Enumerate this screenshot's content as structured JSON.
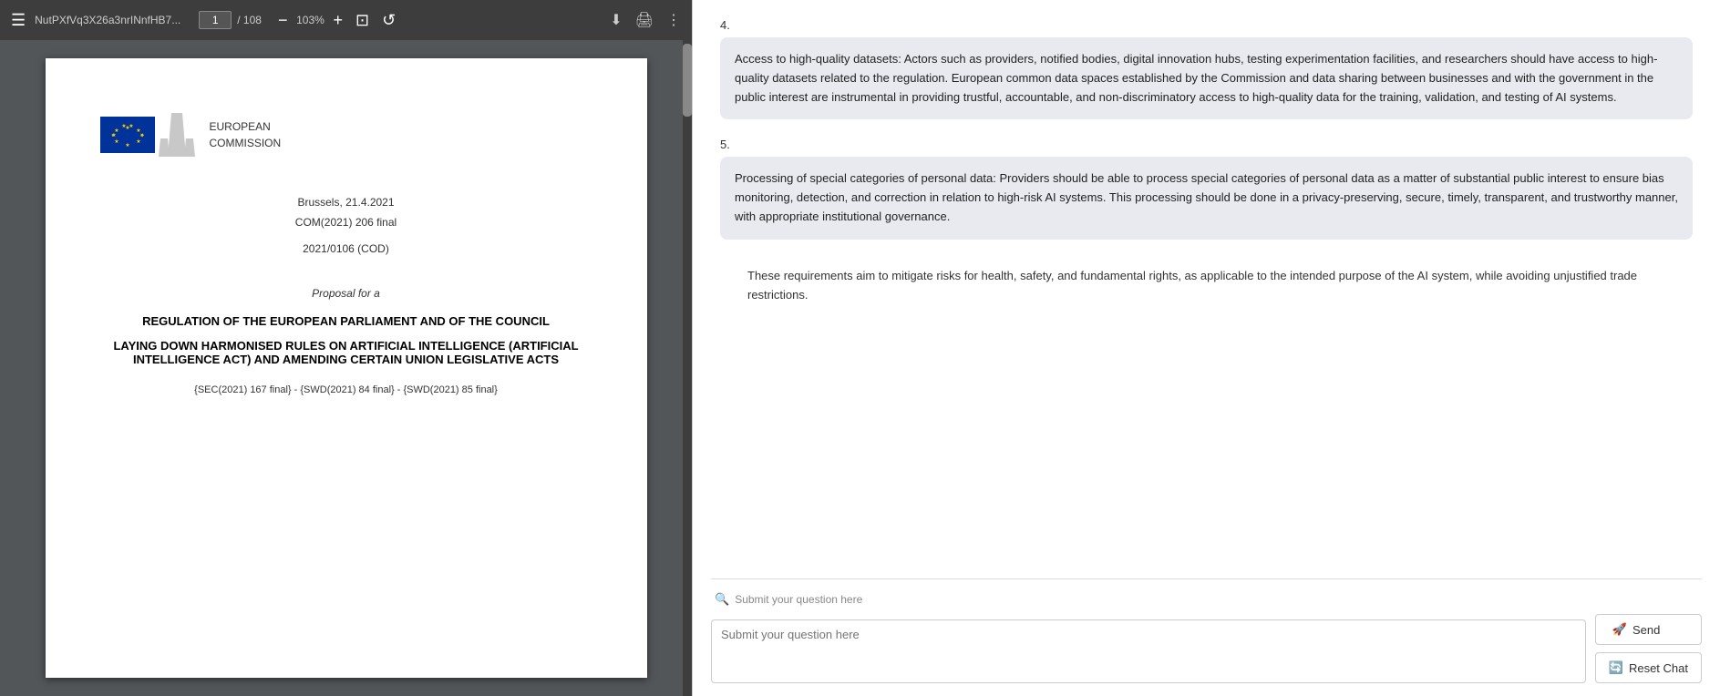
{
  "pdf": {
    "toolbar": {
      "hamburger_label": "☰",
      "filename": "NutPXfVq3X26a3nrINnfHB7...",
      "page_current": "1",
      "page_separator": "/ 108",
      "zoom_minus": "−",
      "zoom_value": "103%",
      "zoom_plus": "+",
      "icon_fit": "⊡",
      "icon_rotate": "↺",
      "icon_download": "⬇",
      "icon_print": "🖨",
      "icon_more": "⋮"
    },
    "document": {
      "eu_text_line1": "EUROPEAN",
      "eu_text_line2": "COMMISSION",
      "meta_line1": "Brussels, 21.4.2021",
      "meta_line2": "COM(2021) 206 final",
      "meta_line3": "",
      "meta_line4": "2021/0106 (COD)",
      "proposal_label": "Proposal for a",
      "title_main": "REGULATION OF THE EUROPEAN PARLIAMENT AND OF THE COUNCIL",
      "title_sub": "LAYING DOWN HARMONISED RULES ON ARTIFICIAL INTELLIGENCE (ARTIFICIAL INTELLIGENCE ACT) AND AMENDING CERTAIN UNION LEGISLATIVE ACTS",
      "references": "{SEC(2021) 167 final} - {SWD(2021) 84 final} - {SWD(2021) 85 final}"
    }
  },
  "chat": {
    "item4": {
      "number": "4.",
      "text": "Access to high-quality datasets: Actors such as providers, notified bodies, digital innovation hubs, testing experimentation facilities, and researchers should have access to high-quality datasets related to the regulation. European common data spaces established by the Commission and data sharing between businesses and with the government in the public interest are instrumental in providing trustful, accountable, and non-discriminatory access to high-quality data for the training, validation, and testing of AI systems."
    },
    "item5": {
      "number": "5.",
      "text": "Processing of special categories of personal data: Providers should be able to process special categories of personal data as a matter of substantial public interest to ensure bias monitoring, detection, and correction in relation to high-risk AI systems. This processing should be done in a privacy-preserving, secure, timely, transparent, and trustworthy manner, with appropriate institutional governance."
    },
    "summary": "These requirements aim to mitigate risks for health, safety, and fundamental rights, as applicable to the intended purpose of the AI system, while avoiding unjustified trade restrictions.",
    "input": {
      "placeholder": "Submit your question here",
      "placeholder_icon": "🔍"
    },
    "buttons": {
      "send_icon": "🚀",
      "send_label": "Send",
      "reset_icon": "🔄",
      "reset_label": "Reset Chat"
    }
  }
}
